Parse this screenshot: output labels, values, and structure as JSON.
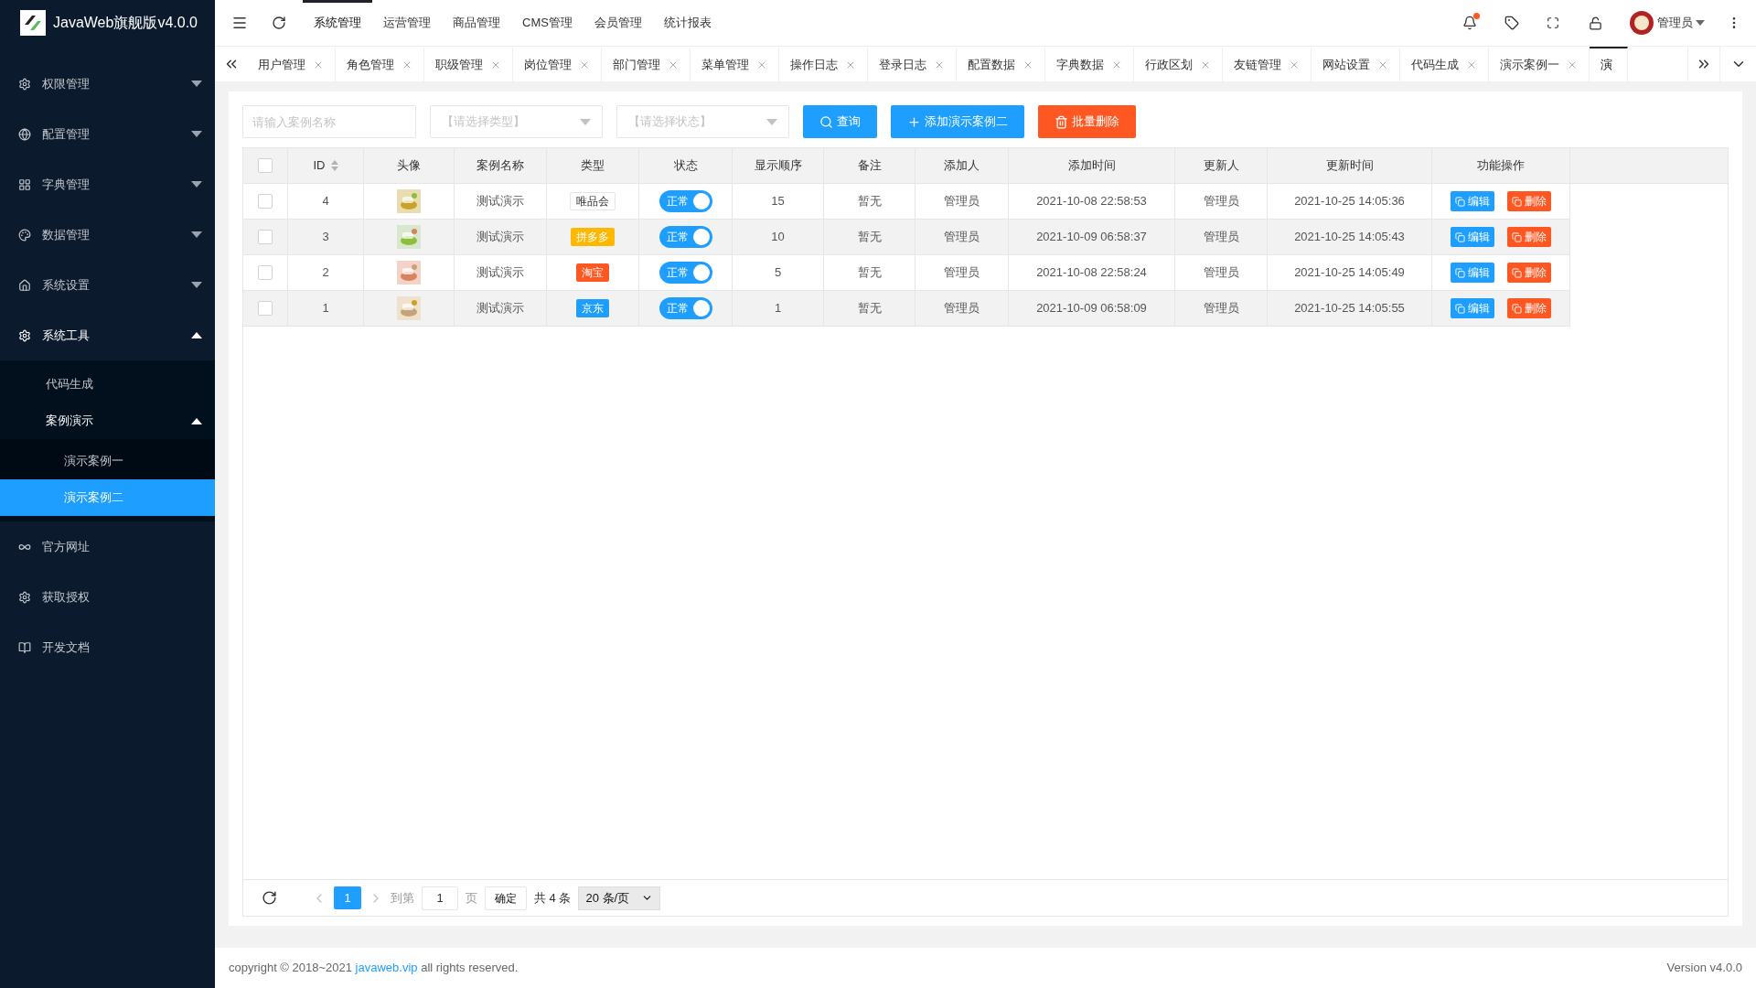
{
  "logo": {
    "title": "JavaWeb旗舰版v4.0.0"
  },
  "sidebar": {
    "items": [
      {
        "label": "权限管理",
        "expanded": false
      },
      {
        "label": "配置管理",
        "expanded": false
      },
      {
        "label": "字典管理",
        "expanded": false
      },
      {
        "label": "数据管理",
        "expanded": false
      },
      {
        "label": "系统设置",
        "expanded": false
      },
      {
        "label": "系统工具",
        "expanded": true,
        "children": [
          {
            "label": "代码生成",
            "selected": false
          },
          {
            "label": "案例演示",
            "expanded": true,
            "children": [
              {
                "label": "演示案例一",
                "selected": false
              },
              {
                "label": "演示案例二",
                "selected": true
              }
            ]
          }
        ]
      },
      {
        "label": "官方网址"
      },
      {
        "label": "获取授权"
      },
      {
        "label": "开发文档"
      }
    ]
  },
  "top_nav": [
    {
      "label": "系统管理",
      "selected": true
    },
    {
      "label": "运营管理",
      "selected": false
    },
    {
      "label": "商品管理",
      "selected": false
    },
    {
      "label": "CMS管理",
      "selected": false
    },
    {
      "label": "会员管理",
      "selected": false
    },
    {
      "label": "统计报表",
      "selected": false
    }
  ],
  "header_right": {
    "has_unread": true,
    "user": "管理员"
  },
  "tabs": [
    {
      "label": "用户管理",
      "selected": false
    },
    {
      "label": "角色管理",
      "selected": false
    },
    {
      "label": "职级管理",
      "selected": false
    },
    {
      "label": "岗位管理",
      "selected": false
    },
    {
      "label": "部门管理",
      "selected": false
    },
    {
      "label": "菜单管理",
      "selected": false
    },
    {
      "label": "操作日志",
      "selected": false
    },
    {
      "label": "登录日志",
      "selected": false
    },
    {
      "label": "配置数据",
      "selected": false
    },
    {
      "label": "字典数据",
      "selected": false
    },
    {
      "label": "行政区划",
      "selected": false
    },
    {
      "label": "友链管理",
      "selected": false
    },
    {
      "label": "网站设置",
      "selected": false
    },
    {
      "label": "代码生成",
      "selected": false
    },
    {
      "label": "演示案例一",
      "selected": false
    },
    {
      "label": "演",
      "selected": true
    }
  ],
  "toolbar": {
    "name_placeholder": "请输入案例名称",
    "type_placeholder": "【请选择类型】",
    "status_placeholder": "【请选择状态】",
    "buttons": [
      {
        "kind": "search",
        "label": "查询"
      },
      {
        "kind": "add",
        "label": "添加演示案例二"
      },
      {
        "kind": "delete",
        "label": "批量删除"
      }
    ]
  },
  "table": {
    "select_all": {
      "checked": false
    },
    "columns": [
      "ID",
      "头像",
      "案例名称",
      "类型",
      "状态",
      "显示顺序",
      "备注",
      "添加人",
      "添加时间",
      "更新人",
      "更新时间",
      "功能操作"
    ],
    "rows": [
      {
        "checked": false,
        "id": "4",
        "name": "测试演示",
        "type": {
          "label": "唯品会",
          "color": "#ffffff"
        },
        "status": {
          "label": "正常",
          "on": true
        },
        "order": "15",
        "remark": "暂无",
        "creator": "管理员",
        "created": "2021-10-08 22:58:53",
        "updater": "管理员",
        "updated": "2021-10-25 14:05:36",
        "actions": [
          {
            "kind": "edit",
            "label": "编辑"
          },
          {
            "kind": "delete",
            "label": "删除"
          }
        ]
      },
      {
        "checked": false,
        "id": "3",
        "name": "测试演示",
        "type": {
          "label": "拼多多",
          "color": "#ffb800"
        },
        "status": {
          "label": "正常",
          "on": true
        },
        "order": "10",
        "remark": "暂无",
        "creator": "管理员",
        "created": "2021-10-09 06:58:37",
        "updater": "管理员",
        "updated": "2021-10-25 14:05:43",
        "actions": [
          {
            "kind": "edit",
            "label": "编辑"
          },
          {
            "kind": "delete",
            "label": "删除"
          }
        ]
      },
      {
        "checked": false,
        "id": "2",
        "name": "测试演示",
        "type": {
          "label": "淘宝",
          "color": "#ff5722"
        },
        "status": {
          "label": "正常",
          "on": true
        },
        "order": "5",
        "remark": "暂无",
        "creator": "管理员",
        "created": "2021-10-08 22:58:24",
        "updater": "管理员",
        "updated": "2021-10-25 14:05:49",
        "actions": [
          {
            "kind": "edit",
            "label": "编辑"
          },
          {
            "kind": "delete",
            "label": "删除"
          }
        ]
      },
      {
        "checked": false,
        "id": "1",
        "name": "测试演示",
        "type": {
          "label": "京东",
          "color": "#1e9fff"
        },
        "status": {
          "label": "正常",
          "on": true
        },
        "order": "1",
        "remark": "暂无",
        "creator": "管理员",
        "created": "2021-10-09 06:58:09",
        "updater": "管理员",
        "updated": "2021-10-25 14:05:55",
        "actions": [
          {
            "kind": "edit",
            "label": "编辑"
          },
          {
            "kind": "delete",
            "label": "删除"
          }
        ]
      }
    ]
  },
  "pagination": {
    "current_page": "1",
    "goto_label": "到第",
    "goto_value": "1",
    "page_unit": "页",
    "confirm": "确定",
    "total": "共 4 条",
    "page_size": "20 条/页"
  },
  "footer": {
    "copyright_before": "copyright © 2018~2021",
    "link": "javaweb.vip",
    "copyright_after": "all rights reserved.",
    "version": "Version v4.0.0"
  }
}
